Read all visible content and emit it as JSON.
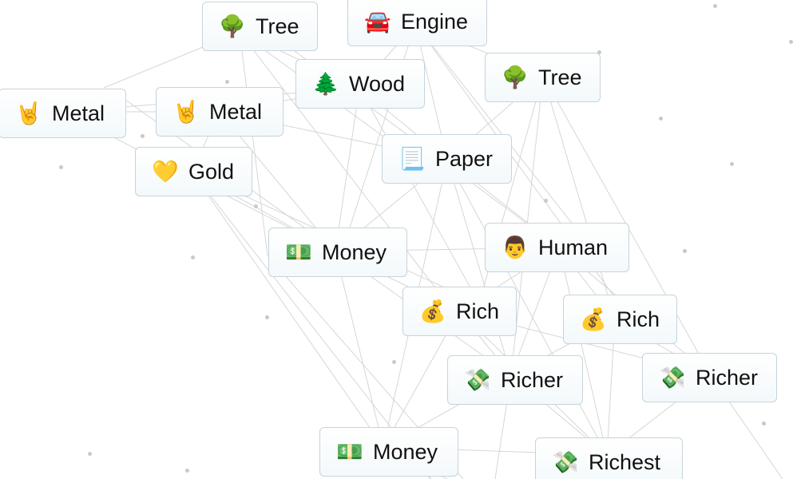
{
  "canvas": {
    "items": [
      {
        "emoji": "🌳",
        "label": "Tree"
      },
      {
        "emoji": "🚘",
        "label": "Engine"
      },
      {
        "emoji": "🌳",
        "label": "Tree"
      },
      {
        "emoji": "🤘",
        "label": "Metal"
      },
      {
        "emoji": "🤘",
        "label": "Metal"
      },
      {
        "emoji": "🌲",
        "label": "Wood"
      },
      {
        "emoji": "💛",
        "label": "Gold"
      },
      {
        "emoji": "📃",
        "label": "Paper"
      },
      {
        "emoji": "💵",
        "label": "Money"
      },
      {
        "emoji": "👨",
        "label": "Human"
      },
      {
        "emoji": "💰",
        "label": "Rich"
      },
      {
        "emoji": "💰",
        "label": "Rich"
      },
      {
        "emoji": "💸",
        "label": "Richer"
      },
      {
        "emoji": "💸",
        "label": "Richer"
      },
      {
        "emoji": "💵",
        "label": "Money"
      },
      {
        "emoji": "💸",
        "label": "Richest"
      }
    ]
  },
  "colors": {
    "item_border": "#c6d3dc",
    "item_bg_bottom": "#f3f9fb",
    "connection_line": "#d6d6d6",
    "background_dot": "#c9c9c9",
    "label_text": "#111111"
  }
}
